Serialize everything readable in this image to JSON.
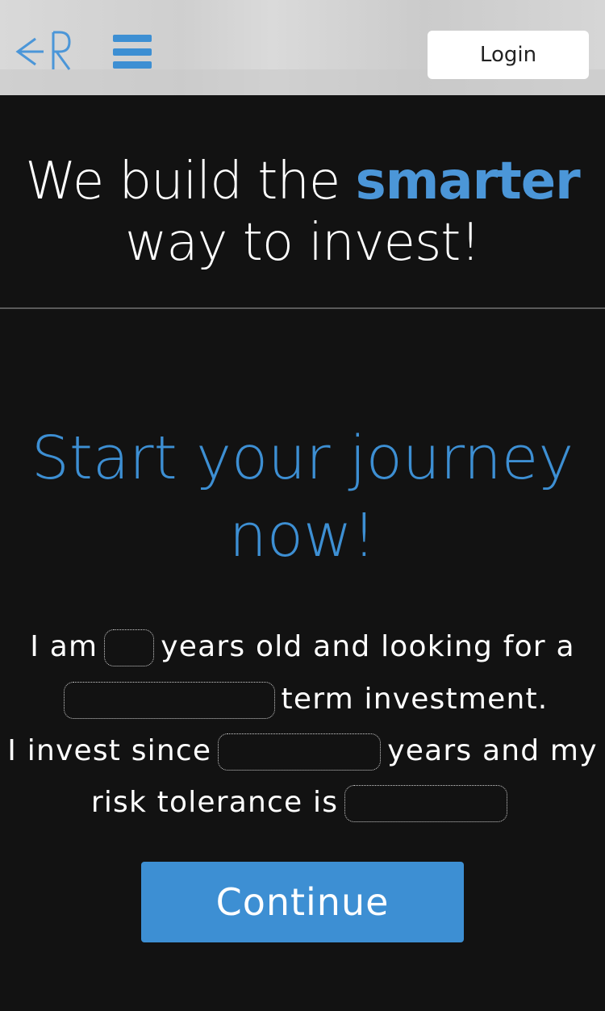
{
  "header": {
    "logo_icon": "rk-arrow-logo-icon",
    "menu_icon": "hamburger-menu-icon",
    "login_label": "Login"
  },
  "hero": {
    "line1_prefix": "We build the ",
    "line1_accent": "smarter",
    "line2": "way to invest!"
  },
  "journey": {
    "title_line1": "Start your journey",
    "title_line2": "now!"
  },
  "form": {
    "s1_prefix": "I am",
    "s1_suffix": "years old and looking for a",
    "s2_suffix": "term investment.",
    "s3_prefix": "I invest since",
    "s3_suffix": "years and my",
    "s4_prefix": "risk tolerance is",
    "age_value": "",
    "term_value": "",
    "since_value": "",
    "risk_value": ""
  },
  "actions": {
    "continue_label": "Continue"
  },
  "colors": {
    "accent": "#3d8fd3",
    "background": "#121212",
    "header_bg": "#d6d6d6"
  }
}
